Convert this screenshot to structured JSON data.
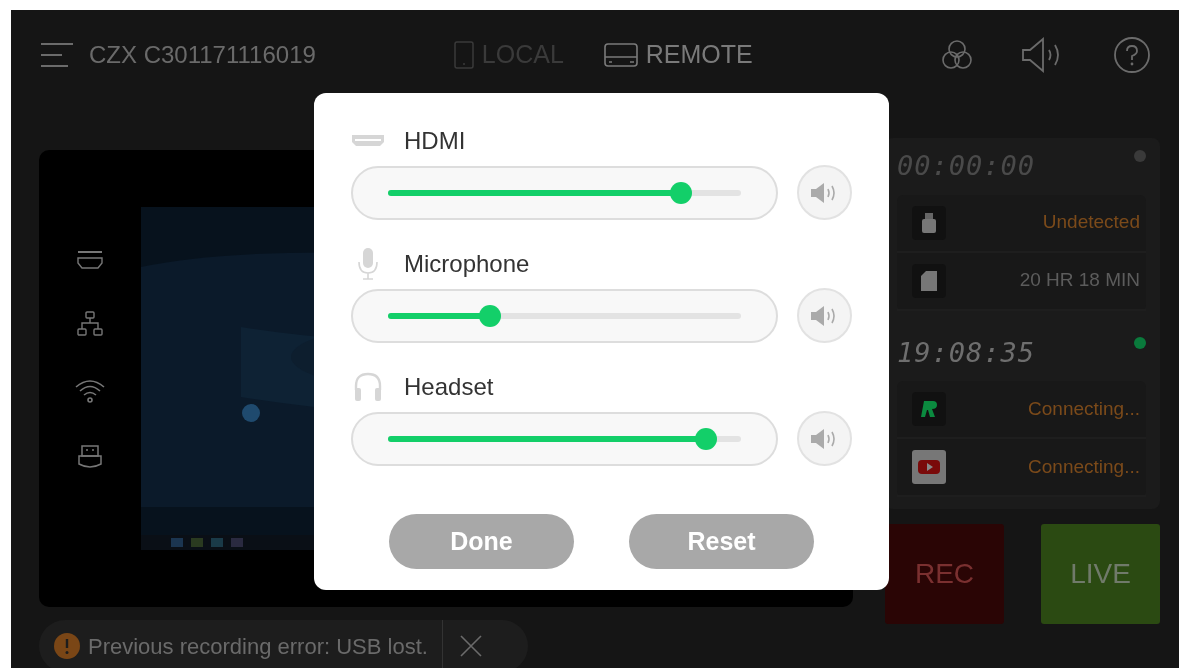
{
  "header": {
    "device_name": "CZX C301171116019",
    "sources": [
      {
        "label": "LOCAL",
        "kind": "tablet",
        "selected": false
      },
      {
        "label": "REMOTE",
        "kind": "box",
        "selected": true
      }
    ]
  },
  "recording": {
    "timer": "00:00:00",
    "active": false,
    "storage": [
      {
        "kind": "usb",
        "status": "Undetected",
        "warning": true
      },
      {
        "kind": "sd",
        "status": "20 HR 18 MIN",
        "warning": false
      }
    ]
  },
  "streaming": {
    "timer": "19:08:35",
    "active": true,
    "platforms": [
      {
        "kind": "r",
        "status": "Connecting...",
        "warning": true
      },
      {
        "kind": "youtube",
        "status": "Connecting...",
        "warning": true
      }
    ]
  },
  "actions": [
    {
      "label": "REC",
      "kind": "rec"
    },
    {
      "label": "LIVE",
      "kind": "live"
    }
  ],
  "toast": {
    "message": "Previous recording error: USB lost."
  },
  "audio_dialog": {
    "channels": [
      {
        "name": "HDMI",
        "kind": "hdmi",
        "level": 0.83
      },
      {
        "name": "Microphone",
        "kind": "mic",
        "level": 0.29
      },
      {
        "name": "Headset",
        "kind": "headset",
        "level": 0.9
      }
    ],
    "buttons": [
      "Done",
      "Reset"
    ]
  }
}
